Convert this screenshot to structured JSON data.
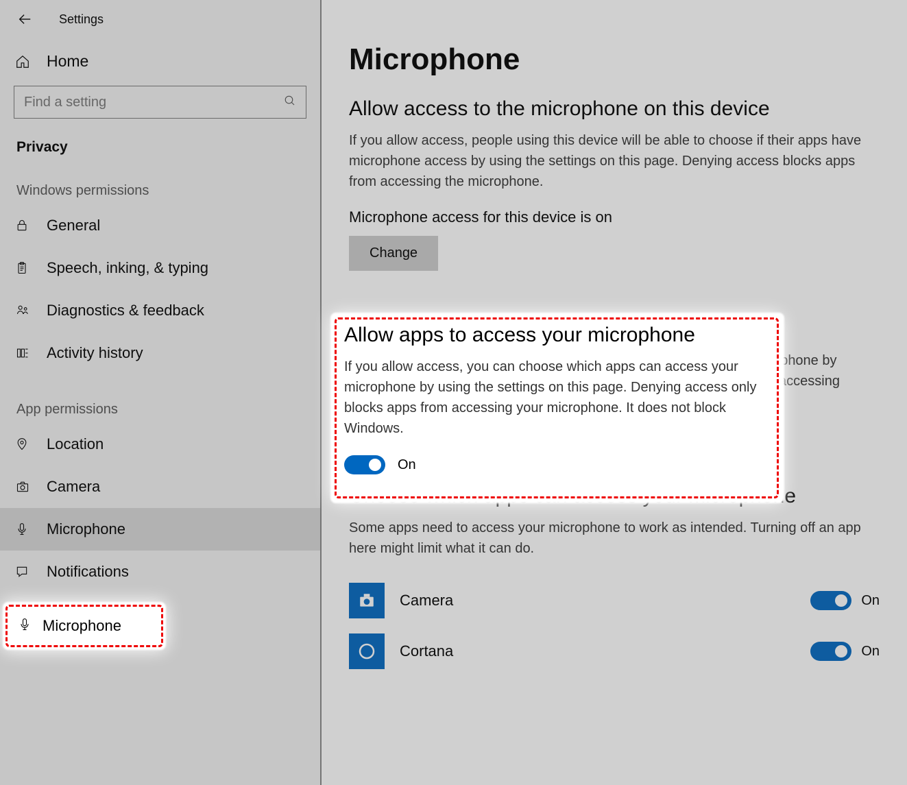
{
  "appTitle": "Settings",
  "sidebar": {
    "homeLabel": "Home",
    "searchPlaceholder": "Find a setting",
    "sectionLabel": "Privacy",
    "group1": "Windows permissions",
    "group2": "App permissions",
    "items": {
      "general": "General",
      "speech": "Speech, inking, & typing",
      "diagnostics": "Diagnostics & feedback",
      "activity": "Activity history",
      "location": "Location",
      "camera": "Camera",
      "microphone": "Microphone",
      "notifications": "Notifications"
    }
  },
  "main": {
    "title": "Microphone",
    "section1": {
      "heading": "Allow access to the microphone on this device",
      "desc": "If you allow access, people using this device will be able to choose if their apps have microphone access by using the settings on this page. Denying access blocks apps from accessing the microphone.",
      "statusLine": "Microphone access for this device is on",
      "changeBtn": "Change"
    },
    "section2": {
      "heading": "Allow apps to access your microphone",
      "desc": "If you allow access, you can choose which apps can access your microphone by using the settings on this page. Denying access only blocks apps from accessing your microphone. It does not block Windows.",
      "toggleState": "On"
    },
    "section3": {
      "heading": "Choose which apps can access your microphone",
      "desc": "Some apps need to access your microphone to work as intended. Turning off an app here might limit what it can do.",
      "apps": [
        {
          "name": "Camera",
          "state": "On"
        },
        {
          "name": "Cortana",
          "state": "On"
        }
      ]
    }
  }
}
